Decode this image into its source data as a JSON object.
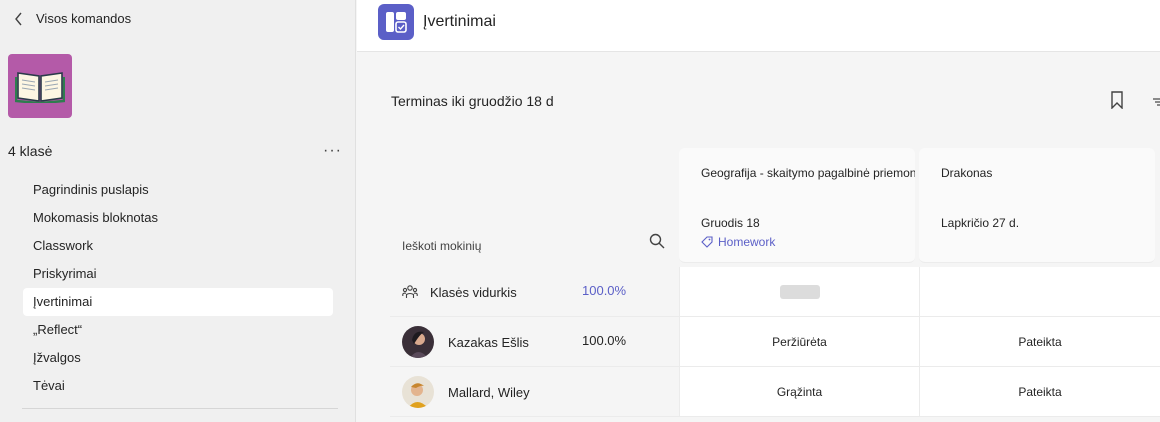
{
  "sidebar": {
    "back_label": "Visos komandos",
    "team_name": "4 klasė",
    "more_label": "···",
    "items": [
      {
        "label": "Pagrindinis puslapis"
      },
      {
        "label": "Mokomasis bloknotas"
      },
      {
        "label": "Classwork"
      },
      {
        "label": "Priskyrimai"
      },
      {
        "label": "Įvertinimai"
      },
      {
        "label": "„Reflect“"
      },
      {
        "label": "Įžvalgos"
      },
      {
        "label": "Tėvai"
      }
    ],
    "active_item": "Įvertinimai"
  },
  "header": {
    "title": "Įvertinimai",
    "icon": "grades-app-icon"
  },
  "main": {
    "due_filter": "Terminas iki gruodžio 18 d",
    "search_placeholder": "Ieškoti mokinių",
    "assignments": [
      {
        "title": "Geografija - skaitymo pagalbinė priemonė",
        "date": "Gruodis 18",
        "tag": "Homework"
      },
      {
        "title": "Drakonas",
        "date": "Lapkričio 27 d."
      }
    ],
    "rows": [
      {
        "name": "Klasės vidurkis",
        "percent": "100.0%",
        "cells": [
          "",
          ""
        ]
      },
      {
        "name": "Kazakas Ešlis",
        "percent": "100.0%",
        "cells": [
          "Peržiūrėta",
          "Pateikta"
        ]
      },
      {
        "name": "Mallard, Wiley",
        "percent": "",
        "cells": [
          "Grąžinta",
          "Pateikta"
        ]
      }
    ]
  },
  "colors": {
    "accent": "#5b5fc7",
    "team_tile": "#b45aa8"
  }
}
